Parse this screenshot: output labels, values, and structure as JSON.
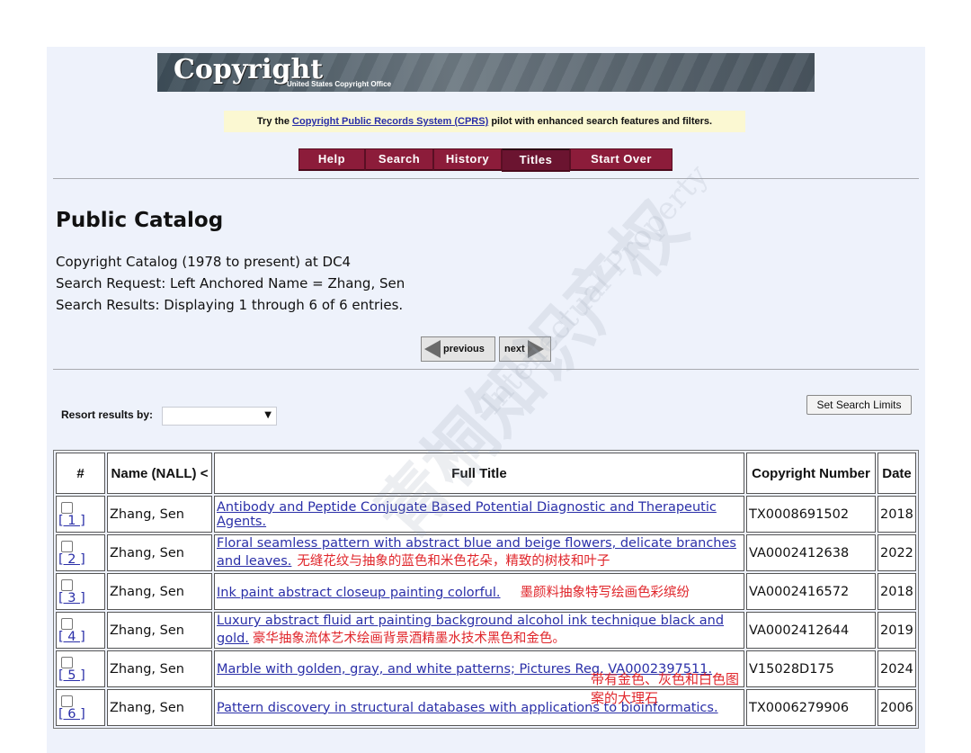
{
  "banner": {
    "logo_text": "Copyright",
    "logo_sub": "United States Copyright Office"
  },
  "cprs": {
    "prefix": "Try the ",
    "link": "Copyright Public Records System (CPRS)",
    "suffix": " pilot with enhanced search features and filters."
  },
  "nav": {
    "help": "Help",
    "search": "Search",
    "history": "History",
    "titles": "Titles",
    "start_over": "Start Over"
  },
  "catalog": {
    "title": "Public Catalog",
    "line1": "Copyright Catalog (1978 to present) at DC4",
    "line2": "Search Request: Left Anchored Name = Zhang, Sen",
    "line3": "Search Results: Displaying 1 through 6 of 6 entries."
  },
  "pager": {
    "previous": "previous",
    "next": "next"
  },
  "resort": {
    "label": "Resort results by:",
    "selected": ""
  },
  "limits_button": "Set Search Limits",
  "table": {
    "headers": {
      "num": "#",
      "name": "Name (NALL) <",
      "title": "Full Title",
      "number": "Copyright Number",
      "date": "Date"
    },
    "rows": [
      {
        "num": "[ 1 ]",
        "name": "Zhang, Sen",
        "title": "Antibody and Peptide Conjugate Based Potential Diagnostic and Therapeutic Agents.",
        "note": "",
        "number": "TX0008691502",
        "date": "2018"
      },
      {
        "num": "[ 2 ]",
        "name": "Zhang, Sen",
        "title": "Floral seamless pattern with abstract blue and beige flowers, delicate branches and leaves.",
        "note": "无缝花纹与抽象的蓝色和米色花朵，精致的树枝和叶子",
        "number": "VA0002412638",
        "date": "2022"
      },
      {
        "num": "[ 3 ]",
        "name": "Zhang, Sen",
        "title": "Ink paint abstract closeup painting colorful.",
        "note": "墨颜料抽象特写绘画色彩缤纷",
        "number": "VA0002416572",
        "date": "2018"
      },
      {
        "num": "[ 4 ]",
        "name": "Zhang, Sen",
        "title": "Luxury abstract fluid art painting background alcohol ink technique black and gold.",
        "note": "豪华抽象流体艺术绘画背景酒精墨水技术黑色和金色。",
        "number": "VA0002412644",
        "date": "2019"
      },
      {
        "num": "[ 5 ]",
        "name": "Zhang, Sen",
        "title": "Marble with golden, gray, and white patterns; Pictures Reg. VA0002397511.",
        "note": "带有金色、灰色和白色图案的大理石",
        "number": "V15028D175",
        "date": "2024"
      },
      {
        "num": "[ 6 ]",
        "name": "Zhang, Sen",
        "title": "Pattern discovery in structural databases with applications to bioinformatics.",
        "note": "",
        "number": "TX0006279906",
        "date": "2006"
      }
    ]
  },
  "watermark": {
    "main": "青桐知识产权",
    "sub": "Intellectual Property"
  }
}
